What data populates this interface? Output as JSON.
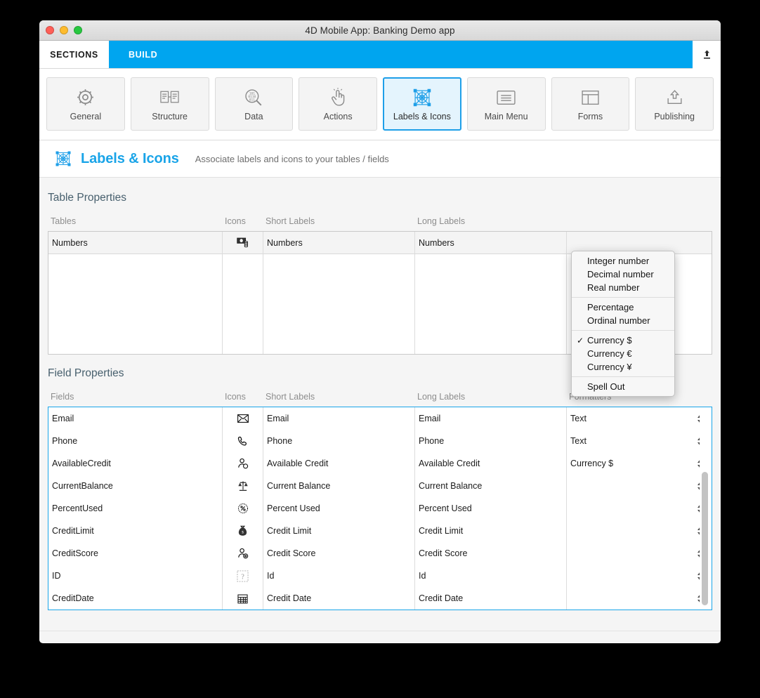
{
  "window": {
    "title": "4D Mobile App: Banking Demo app",
    "traffic_lights": [
      "close",
      "minimize",
      "zoom"
    ]
  },
  "tabs": {
    "sections_label": "SECTIONS",
    "build_label": "BUILD",
    "upload_icon": "upload-icon",
    "accent_color": "#00a5ef"
  },
  "sections": [
    {
      "label": "General",
      "icon": "gear-icon",
      "active": false
    },
    {
      "label": "Structure",
      "icon": "structure-icon",
      "active": false
    },
    {
      "label": "Data",
      "icon": "data-search-icon",
      "active": false
    },
    {
      "label": "Actions",
      "icon": "tap-hand-icon",
      "active": false
    },
    {
      "label": "Labels & Icons",
      "icon": "labels-icons-icon",
      "active": true
    },
    {
      "label": "Main Menu",
      "icon": "menu-list-icon",
      "active": false
    },
    {
      "label": "Forms",
      "icon": "forms-layout-icon",
      "active": false
    },
    {
      "label": "Publishing",
      "icon": "publish-upload-icon",
      "active": false
    }
  ],
  "page": {
    "icon": "labels-icons-icon",
    "title": "Labels & Icons",
    "subtitle": "Associate labels and icons to your tables / fields",
    "title_color": "#19a4e8"
  },
  "table_properties": {
    "block_title": "Table Properties",
    "columns": [
      "Tables",
      "Icons",
      "Short Labels",
      "Long Labels"
    ],
    "rows": [
      {
        "table": "Numbers",
        "icon": "banknotes-icon",
        "short_label": "Numbers",
        "long_label": "Numbers",
        "extra": ""
      }
    ]
  },
  "field_properties": {
    "block_title": "Field Properties",
    "columns": [
      "Fields",
      "Icons",
      "Short Labels",
      "Long Labels",
      "Formatters"
    ],
    "rows": [
      {
        "field": "Email",
        "icon": "envelope-icon",
        "short_label": "Email",
        "long_label": "Email",
        "formatter": "Text"
      },
      {
        "field": "Phone",
        "icon": "phone-handset-icon",
        "short_label": "Phone",
        "long_label": "Phone",
        "formatter": "Text"
      },
      {
        "field": "AvailableCredit",
        "icon": "person-coin-icon",
        "short_label": "Available Credit",
        "long_label": "Available Credit",
        "formatter": "Currency $"
      },
      {
        "field": "CurrentBalance",
        "icon": "scales-balance-icon",
        "short_label": "Current Balance",
        "long_label": "Current Balance",
        "formatter": ""
      },
      {
        "field": "PercentUsed",
        "icon": "percent-badge-icon",
        "short_label": "Percent Used",
        "long_label": "Percent Used",
        "formatter": ""
      },
      {
        "field": "CreditLimit",
        "icon": "money-bag-icon",
        "short_label": "Credit Limit",
        "long_label": "Credit Limit",
        "formatter": ""
      },
      {
        "field": "CreditScore",
        "icon": "person-gear-icon",
        "short_label": "Credit Score",
        "long_label": "Credit Score",
        "formatter": ""
      },
      {
        "field": "ID",
        "icon": "question-mark-icon",
        "short_label": "Id",
        "long_label": "Id",
        "formatter": ""
      },
      {
        "field": "CreditDate",
        "icon": "calendar-icon",
        "short_label": "Credit Date",
        "long_label": "Credit Date",
        "formatter": ""
      }
    ]
  },
  "formatter_menu": {
    "selected": "Currency $",
    "groups": [
      {
        "items": [
          {
            "label": "Integer number",
            "checked": false
          },
          {
            "label": "Decimal number",
            "checked": false
          },
          {
            "label": "Real number",
            "checked": false
          }
        ]
      },
      {
        "items": [
          {
            "label": "Percentage",
            "checked": false
          },
          {
            "label": "Ordinal number",
            "checked": false
          }
        ]
      },
      {
        "items": [
          {
            "label": "Currency $",
            "checked": true
          },
          {
            "label": "Currency €",
            "checked": false
          },
          {
            "label": "Currency ¥",
            "checked": false
          }
        ]
      },
      {
        "items": [
          {
            "label": "Spell Out",
            "checked": false
          }
        ]
      }
    ]
  }
}
